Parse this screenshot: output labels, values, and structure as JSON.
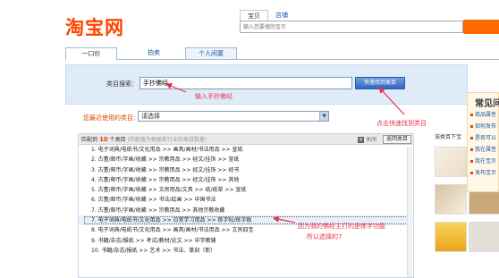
{
  "header": {
    "logo": "淘宝网",
    "search_tabs": [
      "宝贝",
      "店铺"
    ],
    "search_placeholder": "输入您要搜的宝贝"
  },
  "page_tabs": [
    "一口价",
    "拍卖",
    "个人闲置"
  ],
  "category_search": {
    "label": "类目搜索：",
    "value": "手抄佛经",
    "button": "快速找到类目"
  },
  "recent": {
    "label": "您最近使用的类目：",
    "selected": "请选择"
  },
  "results": {
    "prefix": "匹配到",
    "count": "10",
    "suffix": "个类目",
    "hint": "(匹配值为根据各行业的类目数量)",
    "close": "关闭",
    "return": "返回类目",
    "items": [
      "1. 电子词典/电纸书/文化用品 >> 画具/画材/书法用品 >> 宣纸",
      "2. 古董/邮币/字画/收藏 >> 宗教用品 >> 经文/挂饰 >> 宣纸",
      "3. 古董/邮币/字画/收藏 >> 宗教用品 >> 经文/挂饰 >> 经书",
      "4. 古董/邮币/字画/收藏 >> 宗教用品 >> 经文/挂饰 >> 其他",
      "5. 古董/邮币/字画/收藏 >> 文房用品/文具 >> 纸/纸草 >> 宣纸",
      "6. 古董/邮币/字画/收藏 >> 书法/绘画 >> 中国书法",
      "7. 古董/邮币/字画/收藏 >> 宗教用品 >> 其他宗教收藏",
      "7. 电子词典/电纸书/文化用品 >> 日常学习用品 >> 练字帖/练字板",
      "8. 电子词典/电纸书/文化用品 >> 画具/画材/书法用品 >> 文房四宝",
      "9. 书籍/杂志/报纸 >> 考试/教材/论文 >> 中学教辅",
      "10. 书籍/杂志/报纸 >> 艺术 >> 书法、篆刻（新）"
    ]
  },
  "annotations": {
    "input_note": "输入手抄佛经",
    "click_note": "点击快速找到类目",
    "reason_line1": "因为我的佛经主打的是练字功能",
    "reason_line2": "所以选择的7"
  },
  "right_panel": {
    "title": "该类目下宝"
  },
  "side_popup": {
    "title": "常见问",
    "items": [
      "商品属性",
      "如何发布",
      "是否可以",
      "我在属性",
      "我在宝贝",
      "发布宝贝"
    ]
  },
  "colors": {
    "brand": "#ff4400",
    "annotation_red": "#e8334a",
    "panel_blue": "#dfebf8"
  }
}
